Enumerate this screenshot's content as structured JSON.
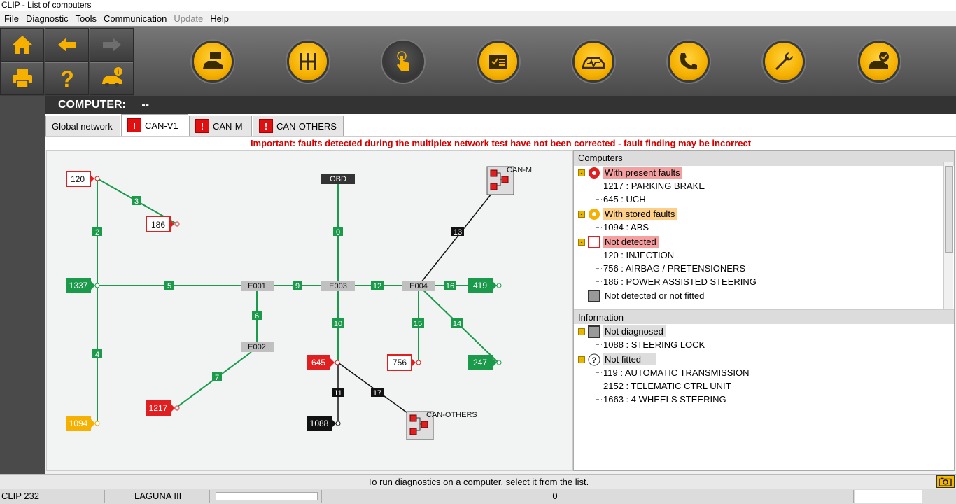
{
  "window": {
    "title": "CLIP - List of computers"
  },
  "menu": [
    "File",
    "Diagnostic",
    "Tools",
    "Communication",
    "Update",
    "Help"
  ],
  "menu_disabled": [
    "Update"
  ],
  "computer": {
    "label": "COMPUTER:",
    "value": "--"
  },
  "tabs": [
    {
      "label": "Global network",
      "warn": false
    },
    {
      "label": "CAN-V1",
      "warn": true,
      "active": true
    },
    {
      "label": "CAN-M",
      "warn": true
    },
    {
      "label": "CAN-OTHERS",
      "warn": true
    }
  ],
  "warning": "Important: faults detected during the multiplex network test have not been corrected - fault finding may be incorrect",
  "computers_section": {
    "title": "Computers",
    "groups": [
      {
        "label": "With present faults",
        "items": [
          "1217 : PARKING BRAKE",
          "645 : UCH"
        ]
      },
      {
        "label": "With stored faults",
        "items": [
          "1094 : ABS"
        ]
      },
      {
        "label": "Not detected",
        "items": [
          "120 : INJECTION",
          "756 : AIRBAG / PRETENSIONERS",
          "186 : POWER ASSISTED STEERING"
        ]
      },
      {
        "label": "Not detected or not fitted",
        "items": []
      }
    ]
  },
  "information_section": {
    "title": "Information",
    "groups": [
      {
        "label": "Not diagnosed",
        "items": [
          "1088 : STEERING LOCK"
        ]
      },
      {
        "label": "Not fitted",
        "items": [
          "119 : AUTOMATIC TRANSMISSION",
          "2152 : TELEMATIC CTRL UNIT",
          "1663 : 4 WHEELS STEERING"
        ]
      }
    ]
  },
  "diagram": {
    "nodes": {
      "n120": "120",
      "n186": "186",
      "n1337": "1337",
      "n1094": "1094",
      "n1217": "1217",
      "n645": "645",
      "n1088": "1088",
      "n756": "756",
      "n419": "419",
      "n247": "247",
      "obd": "OBD",
      "e001": "E001",
      "e002": "E002",
      "e003": "E003",
      "e004": "E004",
      "canm": "CAN-M",
      "canothers": "CAN-OTHERS"
    },
    "links": [
      "0",
      "2",
      "3",
      "4",
      "5",
      "6",
      "7",
      "9",
      "10",
      "11",
      "12",
      "13",
      "14",
      "15",
      "16",
      "17"
    ]
  },
  "status": {
    "message": "To run diagnostics on a computer, select it from the list.",
    "clip": "CLIP 232",
    "vehicle": "LAGUNA III",
    "count": "0"
  },
  "colors": {
    "green": "#1a9a4a",
    "red": "#e02020",
    "orange": "#f5b000",
    "black": "#111111",
    "gray": "#c0c0c0"
  }
}
